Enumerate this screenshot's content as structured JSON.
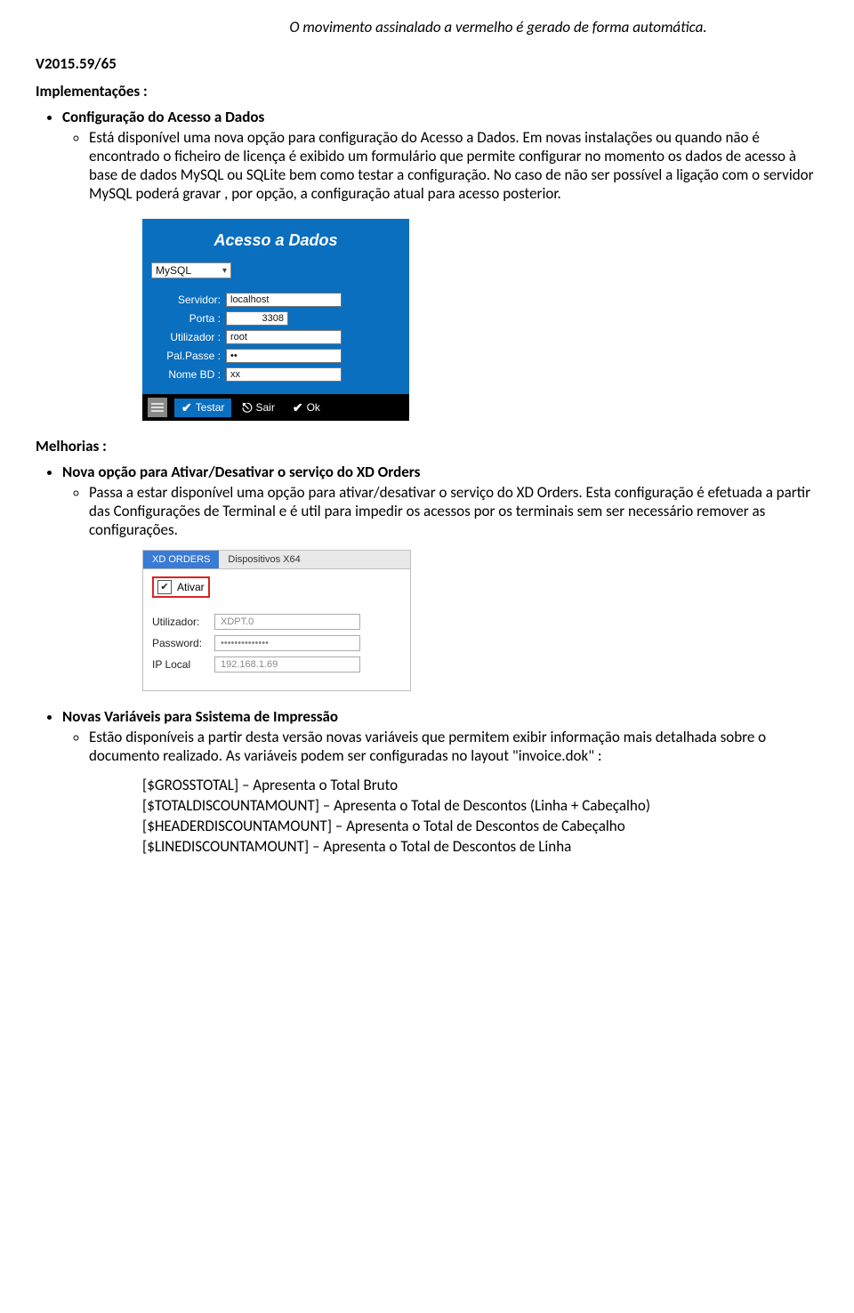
{
  "header_note": "O movimento assinalado a vermelho é gerado de forma automática.",
  "version": "V2015.59/65",
  "sect_impl": "Implementações :",
  "sect_melh": "Melhorias :",
  "impl": {
    "item1_title": "Configuração do Acesso a Dados",
    "item1_sub": "Está disponível uma nova opção para configuração do Acesso a Dados.",
    "item1_para": "Em novas instalações ou quando não é encontrado o ficheiro de licença é exibido um formulário que permite configurar no momento os dados de acesso à base de dados MySQL ou SQLite bem como testar a configuração. No caso de não ser possível a ligação com o servidor MySQL poderá gravar , por opção, a configuração atual para acesso posterior."
  },
  "dlg": {
    "title": "Acesso a Dados",
    "dbtype": "MySQL",
    "lbl_servidor": "Servidor:",
    "val_servidor": "localhost",
    "lbl_porta": "Porta :",
    "val_porta": "3308",
    "lbl_util": "Utilizador :",
    "val_util": "root",
    "lbl_pass": "Pal.Passe :",
    "val_pass": "••",
    "lbl_bd": "Nome BD :",
    "val_bd": "xx",
    "btn_testar": "Testar",
    "btn_sair": "Sair",
    "btn_ok": "Ok"
  },
  "melh1": {
    "title": "Nova opção para Ativar/Desativar o serviço do XD Orders",
    "sub": "Passa a estar disponível uma opção para ativar/desativar o serviço do XD Orders.",
    "para": "Esta configuração é efetuada a partir das Configurações de Terminal e é util para impedir os acessos por os terminais sem ser necessário remover as configurações."
  },
  "xd": {
    "tab_active": "XD ORDERS",
    "tab_other": "Dispositivos X64",
    "ativar": "Ativar",
    "lbl_user": "Utilizador:",
    "val_user": "XDPT.0",
    "lbl_pass": "Password:",
    "val_pass": "••••••••••••••",
    "lbl_ip": "IP Local",
    "val_ip": "192.168.1.69"
  },
  "melh2": {
    "title": "Novas Variáveis para Ssistema de Impressão",
    "sub": "Estão disponíveis a partir desta versão novas variáveis  que permitem exibir informação mais detalhada sobre o documento realizado. As variáveis podem ser configuradas no layout \"invoice.dok\" :",
    "v1": "[$GROSSTOTAL] – Apresenta o Total Bruto",
    "v2": "[$TOTALDISCOUNTAMOUNT] – Apresenta o Total de Descontos (Linha + Cabeçalho)",
    "v3": "[$HEADERDISCOUNTAMOUNT] – Apresenta o Total de Descontos de Cabeçalho",
    "v4": "[$LINEDISCOUNTAMOUNT] – Apresenta o Total de Descontos de Linha"
  },
  "sub_marker": "o"
}
